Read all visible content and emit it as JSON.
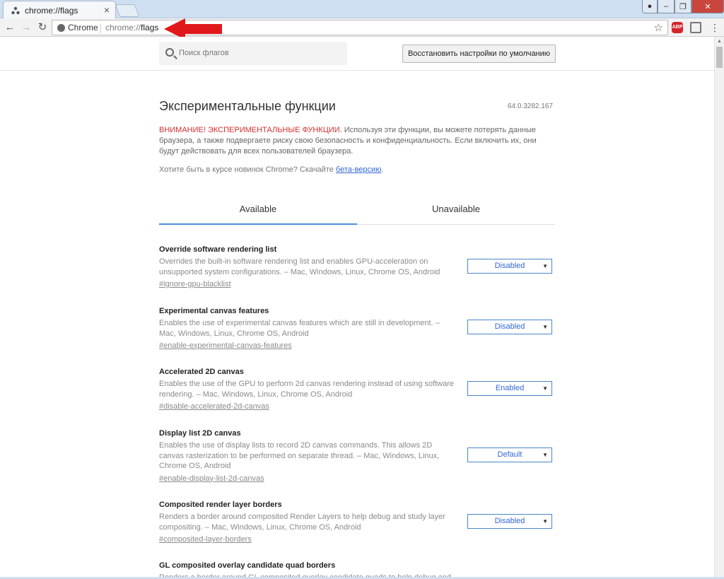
{
  "browser": {
    "tab_title": "chrome://flags",
    "tab_close": "×",
    "site_chip": "Chrome",
    "url_prefix": "chrome://",
    "url_host": "flags",
    "abp_label": "ABP"
  },
  "header": {
    "search_placeholder": "Поиск флагов",
    "reset_label": "Восстановить настройки по умолчанию"
  },
  "main": {
    "title": "Экспериментальные функции",
    "version": "64.0.3282.167",
    "warning_lead": "ВНИМАНИЕ! ЭКСПЕРИМЕНТАЛЬНЫЕ ФУНКЦИИ.",
    "warning_text": " Используя эти функции, вы можете потерять данные браузера, а также подвергаете риску свою безопасность и конфиденциальность. Если включить их, они будут действовать для всех пользователей браузера.",
    "beta_text": "Хотите быть в курсе новинок Chrome? Скачайте ",
    "beta_link": "бета-версию",
    "beta_after": ".",
    "tabs": [
      "Available",
      "Unavailable"
    ]
  },
  "flags": [
    {
      "name": "Override software rendering list",
      "desc": "Overrides the built-in software rendering list and enables GPU-acceleration on unsupported system configurations. – Mac, Windows, Linux, Chrome OS, Android",
      "link": "#ignore-gpu-blacklist",
      "value": "Disabled"
    },
    {
      "name": "Experimental canvas features",
      "desc": "Enables the use of experimental canvas features which are still in development. – Mac, Windows, Linux, Chrome OS, Android",
      "link": "#enable-experimental-canvas-features",
      "value": "Disabled"
    },
    {
      "name": "Accelerated 2D canvas",
      "desc": "Enables the use of the GPU to perform 2d canvas rendering instead of using software rendering. – Mac, Windows, Linux, Chrome OS, Android",
      "link": "#disable-accelerated-2d-canvas",
      "value": "Enabled"
    },
    {
      "name": "Display list 2D canvas",
      "desc": "Enables the use of display lists to record 2D canvas commands. This allows 2D canvas rasterization to be performed on separate thread. – Mac, Windows, Linux, Chrome OS, Android",
      "link": "#enable-display-list-2d-canvas",
      "value": "Default"
    },
    {
      "name": "Composited render layer borders",
      "desc": "Renders a border around composited Render Layers to help debug and study layer compositing. – Mac, Windows, Linux, Chrome OS, Android",
      "link": "#composited-layer-borders",
      "value": "Disabled"
    },
    {
      "name": "GL composited overlay candidate quad borders",
      "desc": "Renders a border around GL composited overlay candidate quads to help debug and study",
      "link": "",
      "value": ""
    }
  ]
}
